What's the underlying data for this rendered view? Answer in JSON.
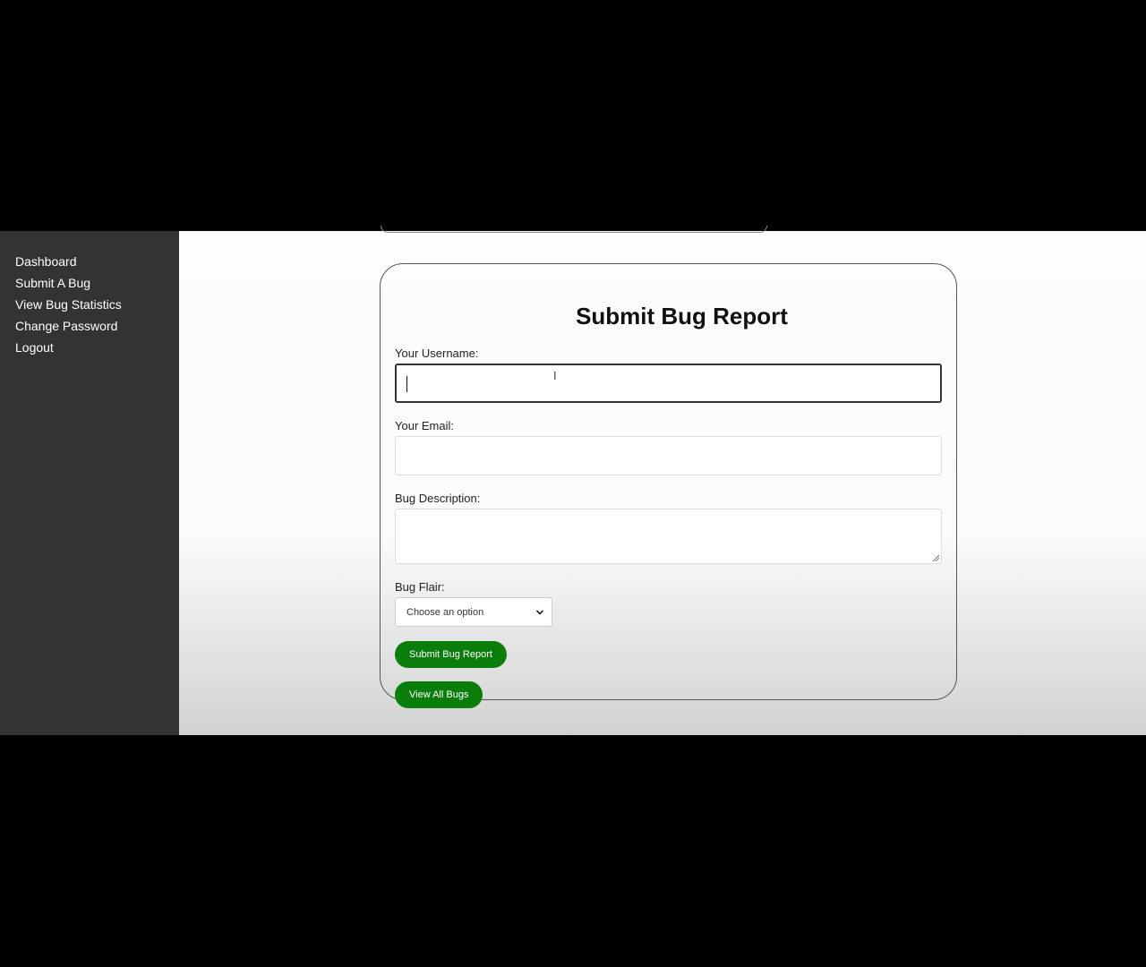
{
  "sidebar": {
    "items": [
      {
        "label": "Dashboard"
      },
      {
        "label": "Submit A Bug"
      },
      {
        "label": "View Bug Statistics"
      },
      {
        "label": "Change Password"
      },
      {
        "label": "Logout"
      }
    ]
  },
  "form": {
    "title": "Submit Bug Report",
    "username_label": "Your Username:",
    "username_value": "",
    "email_label": "Your Email:",
    "email_value": "",
    "description_label": "Bug Description:",
    "description_value": "",
    "flair_label": "Bug Flair:",
    "flair_selected": "Choose an option",
    "submit_label": "Submit Bug Report",
    "view_all_label": "View All Bugs"
  },
  "colors": {
    "sidebar_bg": "#333333",
    "button_bg": "#0a7d0a"
  }
}
